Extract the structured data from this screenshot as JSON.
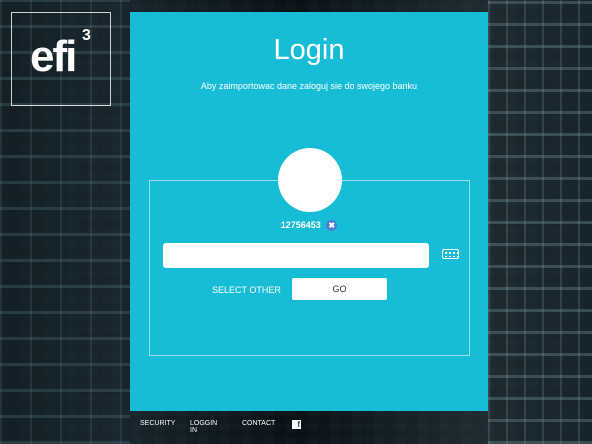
{
  "logo": {
    "text": "efi",
    "superscript": "3"
  },
  "login": {
    "title": "Login",
    "subtitle": "Aby zaimportowac dane zaloguj sie do swojego banku",
    "user_id": "12756453",
    "remove_symbol": "✖",
    "password_value": "",
    "select_other_label": "SELECT OTHER",
    "go_label": "GO"
  },
  "footer": {
    "links": [
      "SECURITY",
      "LOGGIN IN",
      "CONTACT"
    ],
    "social_symbol": "f"
  },
  "colors": {
    "panel": "#17bdd6",
    "remove_badge": "#4a7fd4"
  }
}
